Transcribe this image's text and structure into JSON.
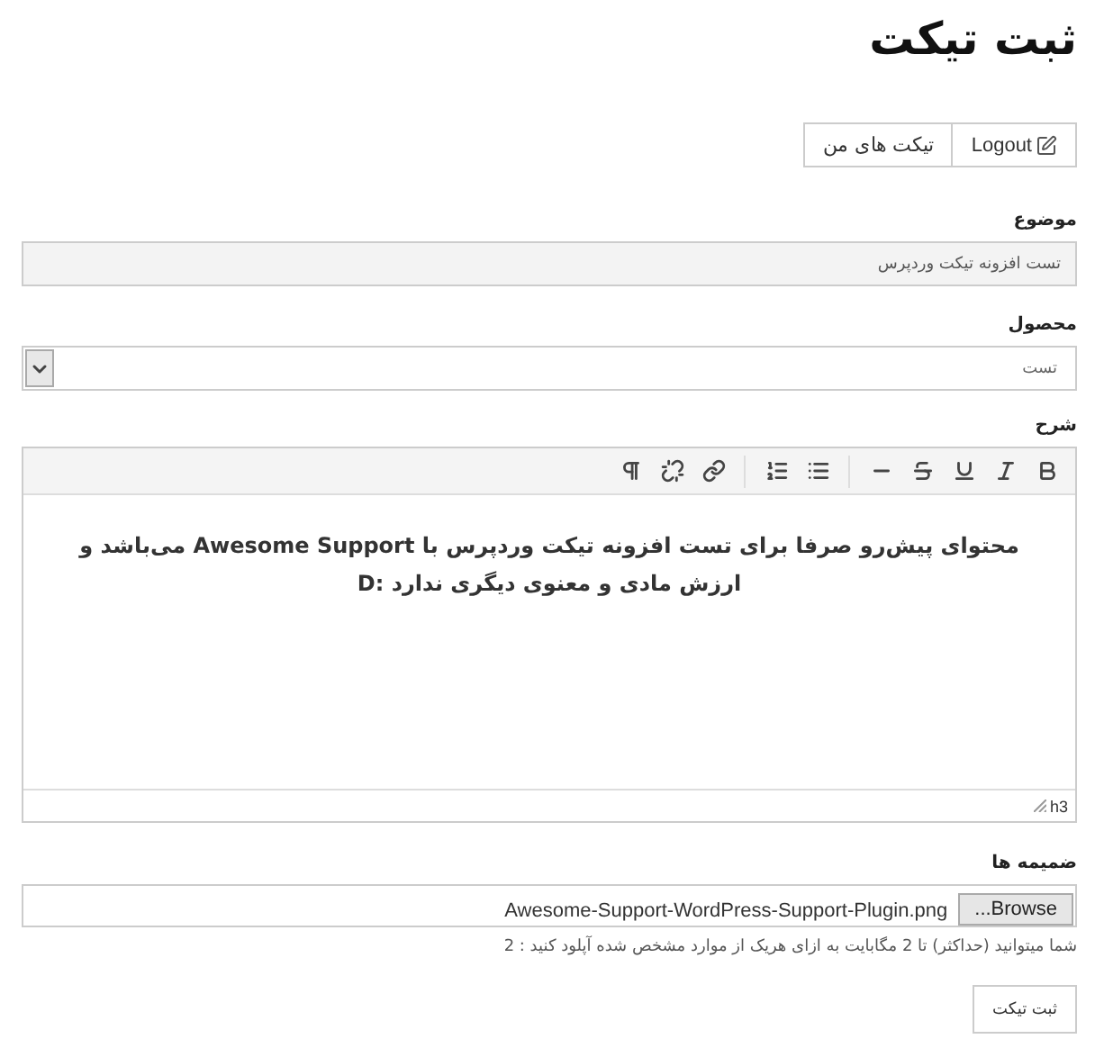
{
  "page_title": "ثبت تیکت",
  "nav_buttons": [
    {
      "label": "Logout",
      "kind": "logout"
    },
    {
      "label": "تیکت های من",
      "kind": "plain"
    }
  ],
  "subject": {
    "label": "موضوع",
    "value": "تست افزونه تیکت وردپرس"
  },
  "product": {
    "label": "محصول",
    "value": "تست"
  },
  "description": {
    "label": "شرح",
    "content": "محتوای پیش‌رو صرفا برای تست افزونه تیکت وردپرس با Awesome Support می‌باشد و ارزش مادی و معنوی دیگری ندارد :D",
    "path": "h3"
  },
  "attachments": {
    "label": "ضمیمه ها",
    "button": "...Browse",
    "file_name": "Awesome-Support-WordPress-Support-Plugin.png",
    "hint": "شما میتوانید (حداکثر) تا 2 مگابایت به ازای هریک از موارد مشخص شده آپلود کنید : 2"
  },
  "submit": {
    "label": "ثبت تیکت"
  }
}
